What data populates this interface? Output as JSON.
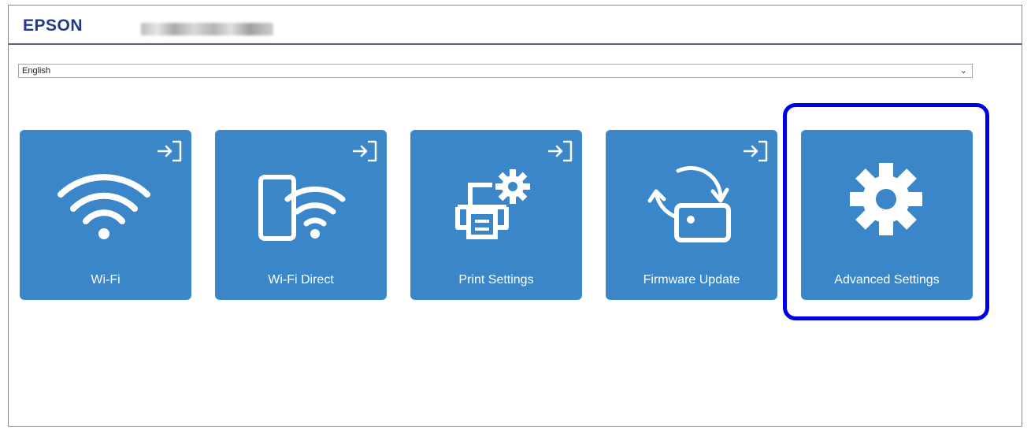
{
  "header": {
    "brand": "EPSON"
  },
  "language": {
    "selected": "English"
  },
  "tiles": [
    {
      "label": "Wi-Fi",
      "icon": "wifi-icon"
    },
    {
      "label": "Wi-Fi Direct",
      "icon": "wifi-direct-icon"
    },
    {
      "label": "Print Settings",
      "icon": "print-settings-icon"
    },
    {
      "label": "Firmware Update",
      "icon": "firmware-update-icon"
    },
    {
      "label": "Advanced Settings",
      "icon": "gear-icon"
    }
  ],
  "colors": {
    "tile": "#3a86c8",
    "highlight": "#0000e6",
    "brand": "#1f3a8a"
  }
}
